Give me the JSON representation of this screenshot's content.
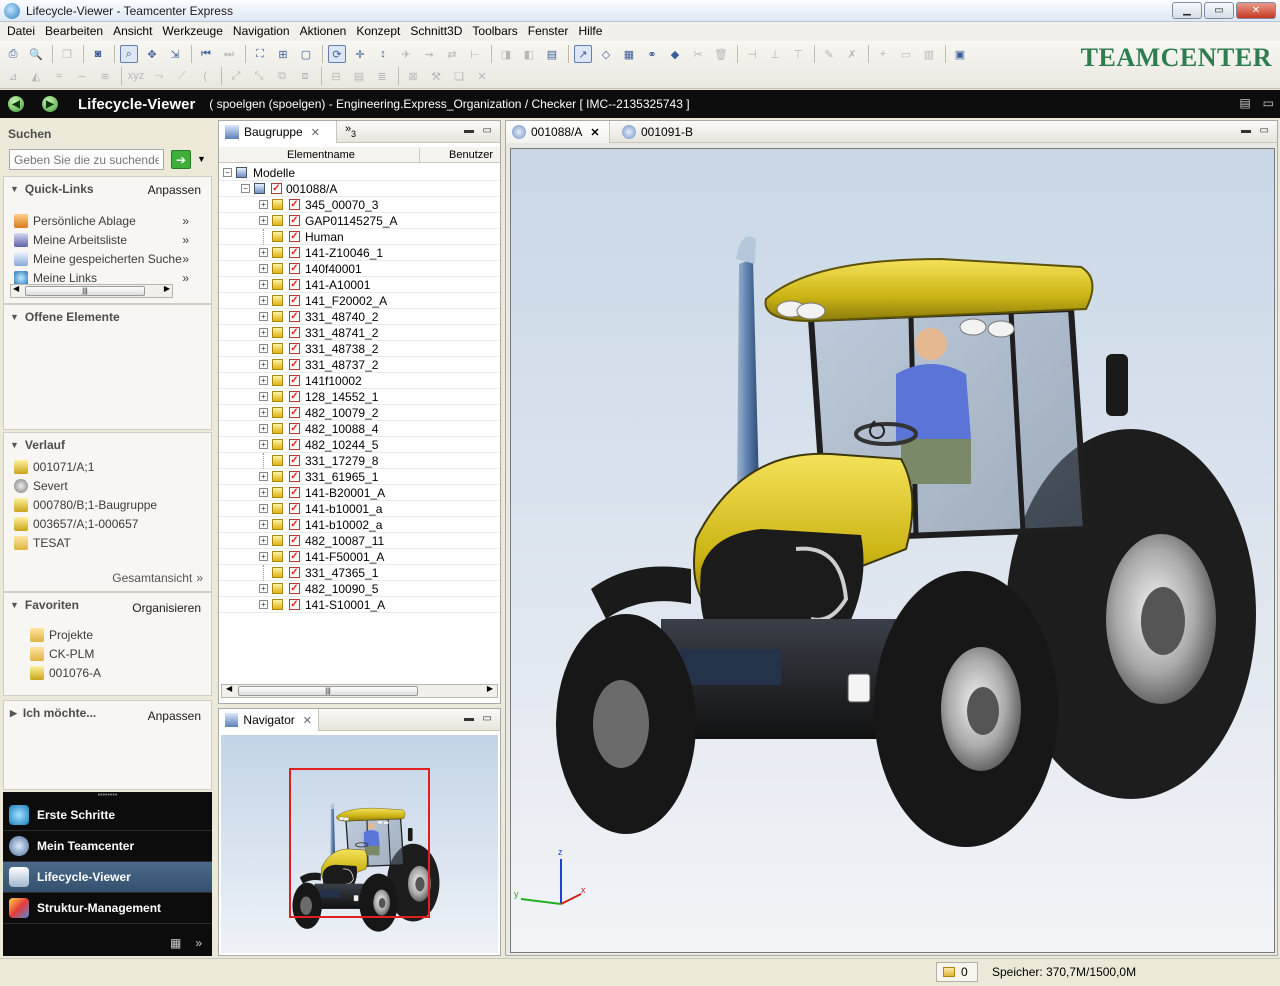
{
  "window": {
    "title": "Lifecycle-Viewer - Teamcenter Express"
  },
  "menu": [
    "Datei",
    "Bearbeiten",
    "Ansicht",
    "Werkzeuge",
    "Navigation",
    "Aktionen",
    "Konzept",
    "Schnitt3D",
    "Toolbars",
    "Fenster",
    "Hilfe"
  ],
  "brand": "TEAMCENTER",
  "perspective": {
    "title": "Lifecycle-Viewer",
    "context": "( spoelgen (spoelgen) - Engineering.Express_Organization / Checker  [ IMC--2135325743 ]"
  },
  "search": {
    "title": "Suchen",
    "placeholder": "Geben Sie die zu suchende"
  },
  "quicklinks": {
    "title": "Quick-Links",
    "action": "Anpassen",
    "items": [
      "Persönliche Ablage",
      "Meine Arbeitsliste",
      "Meine gespeicherten Suche",
      "Meine Links"
    ]
  },
  "open_items": {
    "title": "Offene Elemente"
  },
  "history": {
    "title": "Verlauf",
    "items": [
      "001071/A;1",
      "Severt",
      "000780/B;1-Baugruppe",
      "003657/A;1-000657",
      "TESAT"
    ],
    "more": "Gesamtansicht"
  },
  "favorites": {
    "title": "Favoriten",
    "action": "Organisieren",
    "items": [
      "Projekte",
      "CK-PLM",
      "001076-A"
    ]
  },
  "wish": {
    "title": "Ich möchte...",
    "action": "Anpassen"
  },
  "perspectives": [
    "Erste Schritte",
    "Mein Teamcenter",
    "Lifecycle-Viewer",
    "Struktur-Management"
  ],
  "baugruppe": {
    "tab": "Baugruppe",
    "overflow": "3",
    "col_name": "Elementname",
    "col_user": "Benutzer",
    "root": "Modelle",
    "assembly": "001088/A",
    "items": [
      {
        "name": "345_00070_3",
        "kind": "check"
      },
      {
        "name": "GAP01145275_A",
        "kind": "check"
      },
      {
        "name": "Human",
        "kind": "plain"
      },
      {
        "name": "141-Z10046_1",
        "kind": "check"
      },
      {
        "name": "140f40001",
        "kind": "check"
      },
      {
        "name": "141-A10001",
        "kind": "check"
      },
      {
        "name": "141_F20002_A",
        "kind": "check"
      },
      {
        "name": "331_48740_2",
        "kind": "check"
      },
      {
        "name": "331_48741_2",
        "kind": "check"
      },
      {
        "name": "331_48738_2",
        "kind": "check"
      },
      {
        "name": "331_48737_2",
        "kind": "check"
      },
      {
        "name": "141f10002",
        "kind": "check"
      },
      {
        "name": "128_14552_1",
        "kind": "check"
      },
      {
        "name": "482_10079_2",
        "kind": "check"
      },
      {
        "name": "482_10088_4",
        "kind": "check"
      },
      {
        "name": "482_10244_5",
        "kind": "check"
      },
      {
        "name": "331_17279_8",
        "kind": "plain"
      },
      {
        "name": "331_61965_1",
        "kind": "check"
      },
      {
        "name": "141-B20001_A",
        "kind": "check"
      },
      {
        "name": "141-b10001_a",
        "kind": "check"
      },
      {
        "name": "141-b10002_a",
        "kind": "check"
      },
      {
        "name": "482_10087_11",
        "kind": "check"
      },
      {
        "name": "141-F50001_A",
        "kind": "check"
      },
      {
        "name": "331_47365_1",
        "kind": "plain"
      },
      {
        "name": "482_10090_5",
        "kind": "check"
      },
      {
        "name": "141-S10001_A",
        "kind": "check"
      }
    ]
  },
  "navigator": {
    "tab": "Navigator"
  },
  "viewer": {
    "tabs": [
      "001088/A",
      "001091-B"
    ],
    "axes": [
      "z",
      "y",
      "x"
    ]
  },
  "status": {
    "counter": "0",
    "memory": "Speicher: 370,7M/1500,0M"
  },
  "colors": {
    "accent": "#2e7d4f",
    "tractor_body": "#d8c11a",
    "selection": "#e02020"
  }
}
